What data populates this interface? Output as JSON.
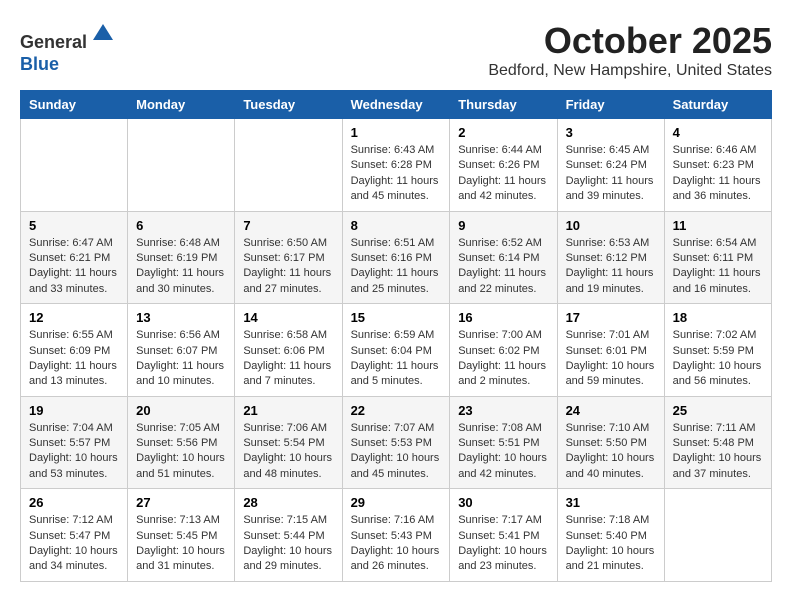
{
  "header": {
    "logo_line1": "General",
    "logo_line2": "Blue",
    "month_title": "October 2025",
    "location": "Bedford, New Hampshire, United States"
  },
  "days_of_week": [
    "Sunday",
    "Monday",
    "Tuesday",
    "Wednesday",
    "Thursday",
    "Friday",
    "Saturday"
  ],
  "weeks": [
    [
      {
        "day": "",
        "sunrise": "",
        "sunset": "",
        "daylight": ""
      },
      {
        "day": "",
        "sunrise": "",
        "sunset": "",
        "daylight": ""
      },
      {
        "day": "",
        "sunrise": "",
        "sunset": "",
        "daylight": ""
      },
      {
        "day": "1",
        "sunrise": "6:43 AM",
        "sunset": "6:28 PM",
        "daylight": "11 hours and 45 minutes."
      },
      {
        "day": "2",
        "sunrise": "6:44 AM",
        "sunset": "6:26 PM",
        "daylight": "11 hours and 42 minutes."
      },
      {
        "day": "3",
        "sunrise": "6:45 AM",
        "sunset": "6:24 PM",
        "daylight": "11 hours and 39 minutes."
      },
      {
        "day": "4",
        "sunrise": "6:46 AM",
        "sunset": "6:23 PM",
        "daylight": "11 hours and 36 minutes."
      }
    ],
    [
      {
        "day": "5",
        "sunrise": "6:47 AM",
        "sunset": "6:21 PM",
        "daylight": "11 hours and 33 minutes."
      },
      {
        "day": "6",
        "sunrise": "6:48 AM",
        "sunset": "6:19 PM",
        "daylight": "11 hours and 30 minutes."
      },
      {
        "day": "7",
        "sunrise": "6:50 AM",
        "sunset": "6:17 PM",
        "daylight": "11 hours and 27 minutes."
      },
      {
        "day": "8",
        "sunrise": "6:51 AM",
        "sunset": "6:16 PM",
        "daylight": "11 hours and 25 minutes."
      },
      {
        "day": "9",
        "sunrise": "6:52 AM",
        "sunset": "6:14 PM",
        "daylight": "11 hours and 22 minutes."
      },
      {
        "day": "10",
        "sunrise": "6:53 AM",
        "sunset": "6:12 PM",
        "daylight": "11 hours and 19 minutes."
      },
      {
        "day": "11",
        "sunrise": "6:54 AM",
        "sunset": "6:11 PM",
        "daylight": "11 hours and 16 minutes."
      }
    ],
    [
      {
        "day": "12",
        "sunrise": "6:55 AM",
        "sunset": "6:09 PM",
        "daylight": "11 hours and 13 minutes."
      },
      {
        "day": "13",
        "sunrise": "6:56 AM",
        "sunset": "6:07 PM",
        "daylight": "11 hours and 10 minutes."
      },
      {
        "day": "14",
        "sunrise": "6:58 AM",
        "sunset": "6:06 PM",
        "daylight": "11 hours and 7 minutes."
      },
      {
        "day": "15",
        "sunrise": "6:59 AM",
        "sunset": "6:04 PM",
        "daylight": "11 hours and 5 minutes."
      },
      {
        "day": "16",
        "sunrise": "7:00 AM",
        "sunset": "6:02 PM",
        "daylight": "11 hours and 2 minutes."
      },
      {
        "day": "17",
        "sunrise": "7:01 AM",
        "sunset": "6:01 PM",
        "daylight": "10 hours and 59 minutes."
      },
      {
        "day": "18",
        "sunrise": "7:02 AM",
        "sunset": "5:59 PM",
        "daylight": "10 hours and 56 minutes."
      }
    ],
    [
      {
        "day": "19",
        "sunrise": "7:04 AM",
        "sunset": "5:57 PM",
        "daylight": "10 hours and 53 minutes."
      },
      {
        "day": "20",
        "sunrise": "7:05 AM",
        "sunset": "5:56 PM",
        "daylight": "10 hours and 51 minutes."
      },
      {
        "day": "21",
        "sunrise": "7:06 AM",
        "sunset": "5:54 PM",
        "daylight": "10 hours and 48 minutes."
      },
      {
        "day": "22",
        "sunrise": "7:07 AM",
        "sunset": "5:53 PM",
        "daylight": "10 hours and 45 minutes."
      },
      {
        "day": "23",
        "sunrise": "7:08 AM",
        "sunset": "5:51 PM",
        "daylight": "10 hours and 42 minutes."
      },
      {
        "day": "24",
        "sunrise": "7:10 AM",
        "sunset": "5:50 PM",
        "daylight": "10 hours and 40 minutes."
      },
      {
        "day": "25",
        "sunrise": "7:11 AM",
        "sunset": "5:48 PM",
        "daylight": "10 hours and 37 minutes."
      }
    ],
    [
      {
        "day": "26",
        "sunrise": "7:12 AM",
        "sunset": "5:47 PM",
        "daylight": "10 hours and 34 minutes."
      },
      {
        "day": "27",
        "sunrise": "7:13 AM",
        "sunset": "5:45 PM",
        "daylight": "10 hours and 31 minutes."
      },
      {
        "day": "28",
        "sunrise": "7:15 AM",
        "sunset": "5:44 PM",
        "daylight": "10 hours and 29 minutes."
      },
      {
        "day": "29",
        "sunrise": "7:16 AM",
        "sunset": "5:43 PM",
        "daylight": "10 hours and 26 minutes."
      },
      {
        "day": "30",
        "sunrise": "7:17 AM",
        "sunset": "5:41 PM",
        "daylight": "10 hours and 23 minutes."
      },
      {
        "day": "31",
        "sunrise": "7:18 AM",
        "sunset": "5:40 PM",
        "daylight": "10 hours and 21 minutes."
      },
      {
        "day": "",
        "sunrise": "",
        "sunset": "",
        "daylight": ""
      }
    ]
  ]
}
